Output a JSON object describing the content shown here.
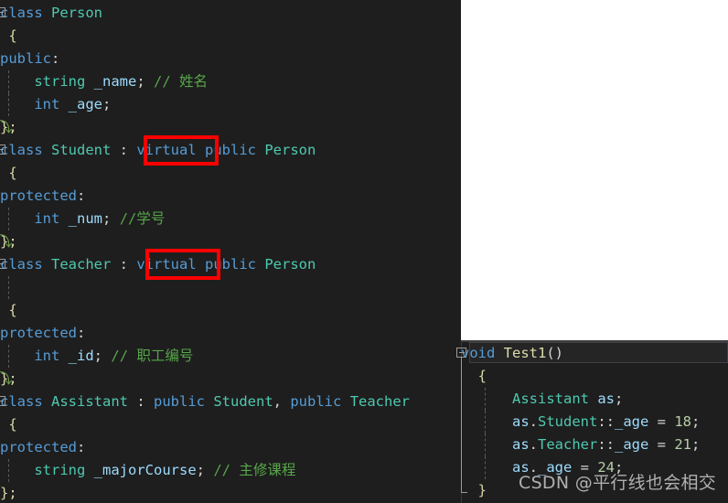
{
  "editor": {
    "background_color": "#1e1e1e",
    "left_pane": {
      "lines": [
        {
          "id": "l1",
          "indent": 0,
          "collapse": true,
          "guide": false,
          "hook": false,
          "tokens": [
            {
              "t": "class ",
              "c": "kw"
            },
            {
              "t": "Person",
              "c": "typ"
            }
          ]
        },
        {
          "id": "l2",
          "indent": 0,
          "collapse": false,
          "guide": false,
          "hook": false,
          "tokens": [
            {
              "t": " {",
              "c": "brace"
            }
          ]
        },
        {
          "id": "l3",
          "indent": 0,
          "collapse": false,
          "guide": false,
          "hook": false,
          "tokens": [
            {
              "t": "public",
              "c": "kw"
            },
            {
              "t": ":",
              "c": "punc"
            }
          ]
        },
        {
          "id": "l4",
          "indent": 0,
          "collapse": false,
          "guide": true,
          "hook": false,
          "tokens": [
            {
              "t": "    ",
              "c": "punc"
            },
            {
              "t": "string",
              "c": "typ"
            },
            {
              "t": " ",
              "c": "punc"
            },
            {
              "t": "_name",
              "c": "id"
            },
            {
              "t": ";",
              "c": "punc"
            },
            {
              "t": " ",
              "c": "punc"
            },
            {
              "t": "// 姓名",
              "c": "cmt"
            }
          ]
        },
        {
          "id": "l5",
          "indent": 0,
          "collapse": false,
          "guide": true,
          "hook": false,
          "tokens": [
            {
              "t": "    ",
              "c": "punc"
            },
            {
              "t": "int",
              "c": "kw"
            },
            {
              "t": " ",
              "c": "punc"
            },
            {
              "t": "_age",
              "c": "id"
            },
            {
              "t": ";",
              "c": "punc"
            }
          ]
        },
        {
          "id": "l6",
          "indent": 0,
          "collapse": false,
          "guide": false,
          "hook": true,
          "tokens": [
            {
              "t": "};",
              "c": "brace"
            }
          ]
        },
        {
          "id": "l7",
          "indent": 0,
          "collapse": true,
          "guide": false,
          "hook": false,
          "tokens": [
            {
              "t": "class ",
              "c": "kw"
            },
            {
              "t": "Student",
              "c": "typ"
            },
            {
              "t": " : ",
              "c": "punc"
            },
            {
              "t": "virtual",
              "c": "kw"
            },
            {
              "t": " ",
              "c": "punc"
            },
            {
              "t": "public",
              "c": "kw"
            },
            {
              "t": " ",
              "c": "punc"
            },
            {
              "t": "Person",
              "c": "typ"
            }
          ]
        },
        {
          "id": "l8",
          "indent": 0,
          "collapse": false,
          "guide": false,
          "hook": false,
          "tokens": [
            {
              "t": " {",
              "c": "brace"
            }
          ]
        },
        {
          "id": "l9",
          "indent": 0,
          "collapse": false,
          "guide": false,
          "hook": false,
          "tokens": [
            {
              "t": "protected",
              "c": "kw"
            },
            {
              "t": ":",
              "c": "punc"
            }
          ]
        },
        {
          "id": "l10",
          "indent": 0,
          "collapse": false,
          "guide": true,
          "hook": false,
          "tokens": [
            {
              "t": "    ",
              "c": "punc"
            },
            {
              "t": "int",
              "c": "kw"
            },
            {
              "t": " ",
              "c": "punc"
            },
            {
              "t": "_num",
              "c": "id"
            },
            {
              "t": ";",
              "c": "punc"
            },
            {
              "t": " ",
              "c": "punc"
            },
            {
              "t": "//学号",
              "c": "cmt"
            }
          ]
        },
        {
          "id": "l11",
          "indent": 0,
          "collapse": false,
          "guide": false,
          "hook": true,
          "tokens": [
            {
              "t": "};",
              "c": "brace"
            }
          ]
        },
        {
          "id": "l12",
          "indent": 0,
          "collapse": true,
          "guide": false,
          "hook": false,
          "tokens": [
            {
              "t": "class ",
              "c": "kw"
            },
            {
              "t": "Teacher",
              "c": "typ"
            },
            {
              "t": " : ",
              "c": "punc"
            },
            {
              "t": "virtual",
              "c": "kw"
            },
            {
              "t": " ",
              "c": "punc"
            },
            {
              "t": "public",
              "c": "kw"
            },
            {
              "t": " ",
              "c": "punc"
            },
            {
              "t": "Person",
              "c": "typ"
            }
          ]
        },
        {
          "id": "l13",
          "indent": 0,
          "collapse": false,
          "guide": true,
          "hook": false,
          "tokens": [
            {
              "t": "",
              "c": "punc"
            }
          ]
        },
        {
          "id": "l14",
          "indent": 0,
          "collapse": false,
          "guide": false,
          "hook": false,
          "tokens": [
            {
              "t": " {",
              "c": "brace"
            }
          ]
        },
        {
          "id": "l15",
          "indent": 0,
          "collapse": false,
          "guide": false,
          "hook": false,
          "tokens": [
            {
              "t": "protected",
              "c": "kw"
            },
            {
              "t": ":",
              "c": "punc"
            }
          ]
        },
        {
          "id": "l16",
          "indent": 0,
          "collapse": false,
          "guide": true,
          "hook": false,
          "tokens": [
            {
              "t": "    ",
              "c": "punc"
            },
            {
              "t": "int",
              "c": "kw"
            },
            {
              "t": " ",
              "c": "punc"
            },
            {
              "t": "_id",
              "c": "id"
            },
            {
              "t": ";",
              "c": "punc"
            },
            {
              "t": " ",
              "c": "punc"
            },
            {
              "t": "// 职工编号",
              "c": "cmt"
            }
          ]
        },
        {
          "id": "l17",
          "indent": 0,
          "collapse": false,
          "guide": false,
          "hook": true,
          "tokens": [
            {
              "t": "};",
              "c": "brace"
            }
          ]
        },
        {
          "id": "l18",
          "indent": 0,
          "collapse": true,
          "guide": false,
          "hook": false,
          "tokens": [
            {
              "t": "class ",
              "c": "kw"
            },
            {
              "t": "Assistant",
              "c": "typ"
            },
            {
              "t": " : ",
              "c": "punc"
            },
            {
              "t": "public",
              "c": "kw"
            },
            {
              "t": " ",
              "c": "punc"
            },
            {
              "t": "Student",
              "c": "typ"
            },
            {
              "t": ", ",
              "c": "punc"
            },
            {
              "t": "public",
              "c": "kw"
            },
            {
              "t": " ",
              "c": "punc"
            },
            {
              "t": "Teacher",
              "c": "typ"
            }
          ]
        },
        {
          "id": "l19",
          "indent": 0,
          "collapse": false,
          "guide": false,
          "hook": false,
          "tokens": [
            {
              "t": " {",
              "c": "brace"
            }
          ]
        },
        {
          "id": "l20",
          "indent": 0,
          "collapse": false,
          "guide": false,
          "hook": false,
          "tokens": [
            {
              "t": "protected",
              "c": "kw"
            },
            {
              "t": ":",
              "c": "punc"
            }
          ]
        },
        {
          "id": "l21",
          "indent": 0,
          "collapse": false,
          "guide": true,
          "hook": false,
          "tokens": [
            {
              "t": "    ",
              "c": "punc"
            },
            {
              "t": "string",
              "c": "typ"
            },
            {
              "t": " ",
              "c": "punc"
            },
            {
              "t": "_majorCourse",
              "c": "id"
            },
            {
              "t": ";",
              "c": "punc"
            },
            {
              "t": " ",
              "c": "punc"
            },
            {
              "t": "// 主修课程",
              "c": "cmt"
            }
          ]
        },
        {
          "id": "l22",
          "indent": 0,
          "collapse": false,
          "guide": false,
          "hook": false,
          "tokens": [
            {
              "t": "};",
              "c": "brace"
            }
          ]
        }
      ]
    },
    "right_pane": {
      "lines": [
        {
          "id": "r1",
          "highlight": true,
          "guide": false,
          "tokens": [
            {
              "t": "void",
              "c": "kw"
            },
            {
              "t": " ",
              "c": "punc"
            },
            {
              "t": "Test1",
              "c": "fn"
            },
            {
              "t": "()",
              "c": "punc"
            }
          ]
        },
        {
          "id": "r2",
          "highlight": false,
          "guide": false,
          "tokens": [
            {
              "t": "  {",
              "c": "brace"
            }
          ]
        },
        {
          "id": "r3",
          "highlight": false,
          "guide": true,
          "tokens": [
            {
              "t": "      ",
              "c": "punc"
            },
            {
              "t": "Assistant",
              "c": "typ"
            },
            {
              "t": " ",
              "c": "punc"
            },
            {
              "t": "as",
              "c": "id"
            },
            {
              "t": ";",
              "c": "punc"
            }
          ]
        },
        {
          "id": "r4",
          "highlight": false,
          "guide": true,
          "tokens": [
            {
              "t": "      ",
              "c": "punc"
            },
            {
              "t": "as",
              "c": "id"
            },
            {
              "t": ".",
              "c": "punc"
            },
            {
              "t": "Student",
              "c": "typ"
            },
            {
              "t": "::",
              "c": "punc"
            },
            {
              "t": "_age",
              "c": "id"
            },
            {
              "t": " = ",
              "c": "punc"
            },
            {
              "t": "18",
              "c": "num"
            },
            {
              "t": ";",
              "c": "punc"
            }
          ]
        },
        {
          "id": "r5",
          "highlight": false,
          "guide": true,
          "tokens": [
            {
              "t": "      ",
              "c": "punc"
            },
            {
              "t": "as",
              "c": "id"
            },
            {
              "t": ".",
              "c": "punc"
            },
            {
              "t": "Teacher",
              "c": "typ"
            },
            {
              "t": "::",
              "c": "punc"
            },
            {
              "t": "_age",
              "c": "id"
            },
            {
              "t": " = ",
              "c": "punc"
            },
            {
              "t": "21",
              "c": "num"
            },
            {
              "t": ";",
              "c": "punc"
            }
          ]
        },
        {
          "id": "r6",
          "highlight": false,
          "guide": true,
          "tokens": [
            {
              "t": "      ",
              "c": "punc"
            },
            {
              "t": "as",
              "c": "id"
            },
            {
              "t": ".",
              "c": "punc"
            },
            {
              "t": "_age",
              "c": "id"
            },
            {
              "t": " = ",
              "c": "punc"
            },
            {
              "t": "24",
              "c": "num"
            },
            {
              "t": ";",
              "c": "punc"
            }
          ]
        },
        {
          "id": "r7",
          "highlight": false,
          "guide": false,
          "tokens": [
            {
              "t": "  }",
              "c": "brace"
            }
          ]
        }
      ]
    }
  },
  "annotations": {
    "color": "#ff0000",
    "boxes": [
      {
        "id": "redbox-student",
        "label": "virtual"
      },
      {
        "id": "redbox-teacher",
        "label": "virtual"
      }
    ]
  },
  "image_placeholder": {
    "icon": "broken-image-icon",
    "background_color": "#ffffff"
  },
  "watermark": {
    "text": "CSDN @平行线也会相交"
  }
}
